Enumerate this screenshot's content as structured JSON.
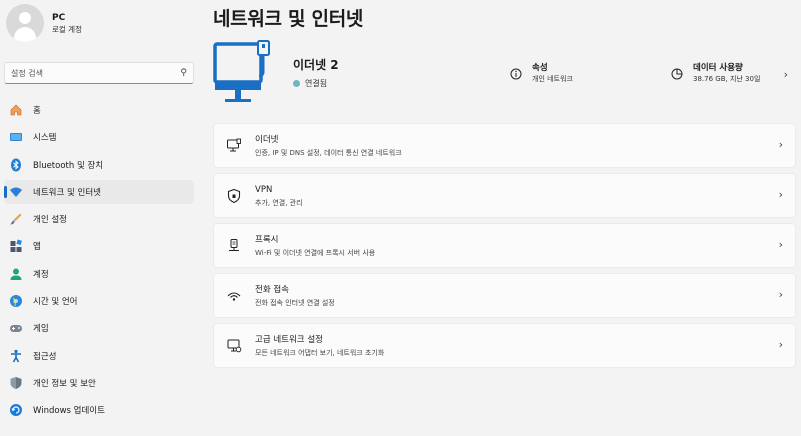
{
  "user": {
    "name": "PC",
    "account_type": "로컬 계정"
  },
  "search": {
    "placeholder": "설정 검색"
  },
  "nav": {
    "items": [
      {
        "label": "홈",
        "icon": "home-icon"
      },
      {
        "label": "시스템",
        "icon": "system-icon"
      },
      {
        "label": "Bluetooth 및 장치",
        "icon": "bluetooth-icon"
      },
      {
        "label": "네트워크 및 인터넷",
        "icon": "network-icon",
        "active": true
      },
      {
        "label": "개인 설정",
        "icon": "brush-icon"
      },
      {
        "label": "앱",
        "icon": "apps-icon"
      },
      {
        "label": "계정",
        "icon": "account-icon"
      },
      {
        "label": "시간 및 언어",
        "icon": "globe-icon"
      },
      {
        "label": "게임",
        "icon": "gamepad-icon"
      },
      {
        "label": "접근성",
        "icon": "accessibility-icon"
      },
      {
        "label": "개인 정보 및 보안",
        "icon": "shield-icon"
      },
      {
        "label": "Windows 업데이트",
        "icon": "update-icon"
      }
    ]
  },
  "page": {
    "title": "네트워크 및 인터넷"
  },
  "hero": {
    "name": "이더넷 2",
    "status": "연결됨",
    "properties": {
      "title": "속성",
      "subtitle": "개인 네트워크"
    },
    "data_usage": {
      "title": "데이터 사용량",
      "subtitle": "38.76 GB, 지난 30일"
    }
  },
  "cards": [
    {
      "title": "이더넷",
      "subtitle": "인증, IP 및 DNS 설정, 데이터 통신 연결 네트워크",
      "icon": "ethernet-icon"
    },
    {
      "title": "VPN",
      "subtitle": "추가, 연결, 관리",
      "icon": "vpn-shield-icon"
    },
    {
      "title": "프록시",
      "subtitle": "Wi-Fi 및 이더넷 연결에 프록시 서버 사용",
      "icon": "proxy-icon"
    },
    {
      "title": "전화 접속",
      "subtitle": "전화 접속 인터넷 연결 설정",
      "icon": "dialup-icon"
    },
    {
      "title": "고급 네트워크 설정",
      "subtitle": "모든 네트워크 어댑터 보기, 네트워크 초기화",
      "icon": "advanced-network-icon"
    }
  ],
  "colors": {
    "accent": "#1a6fc4",
    "background": "#f3f3f3",
    "card": "#fbfbfb"
  }
}
